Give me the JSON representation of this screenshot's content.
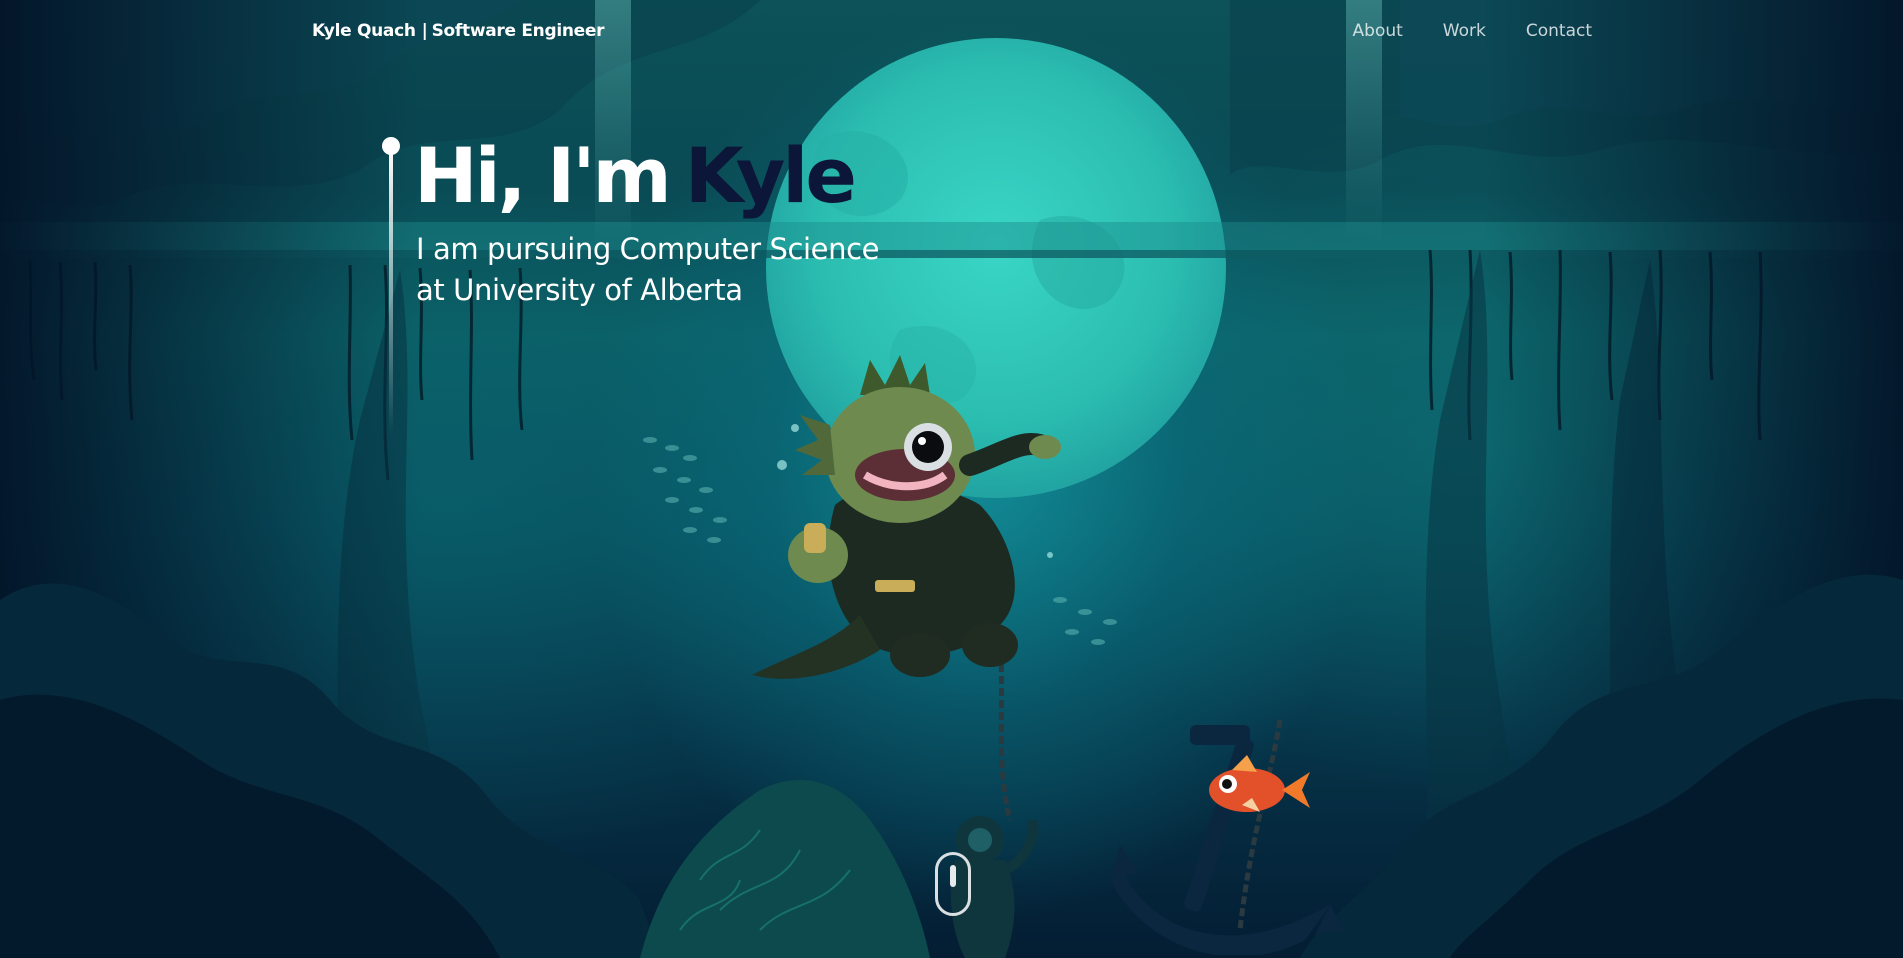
{
  "header": {
    "brand_name": "Kyle Quach",
    "brand_separator": "|",
    "brand_role": "Software Engineer",
    "nav": [
      {
        "label": "About"
      },
      {
        "label": "Work"
      },
      {
        "label": "Contact"
      }
    ]
  },
  "hero": {
    "greeting": "Hi, I'm",
    "name": "Kyle",
    "subtitle_line1": "I am pursuing Computer Science",
    "subtitle_line2": "at University of Alberta"
  },
  "colors": {
    "accent_name": "#0b1638",
    "water": "#0b6066",
    "moon": "#2ec2b4",
    "fish": "#e2512a"
  },
  "icons": {
    "scroll": "mouse-scroll-icon"
  }
}
